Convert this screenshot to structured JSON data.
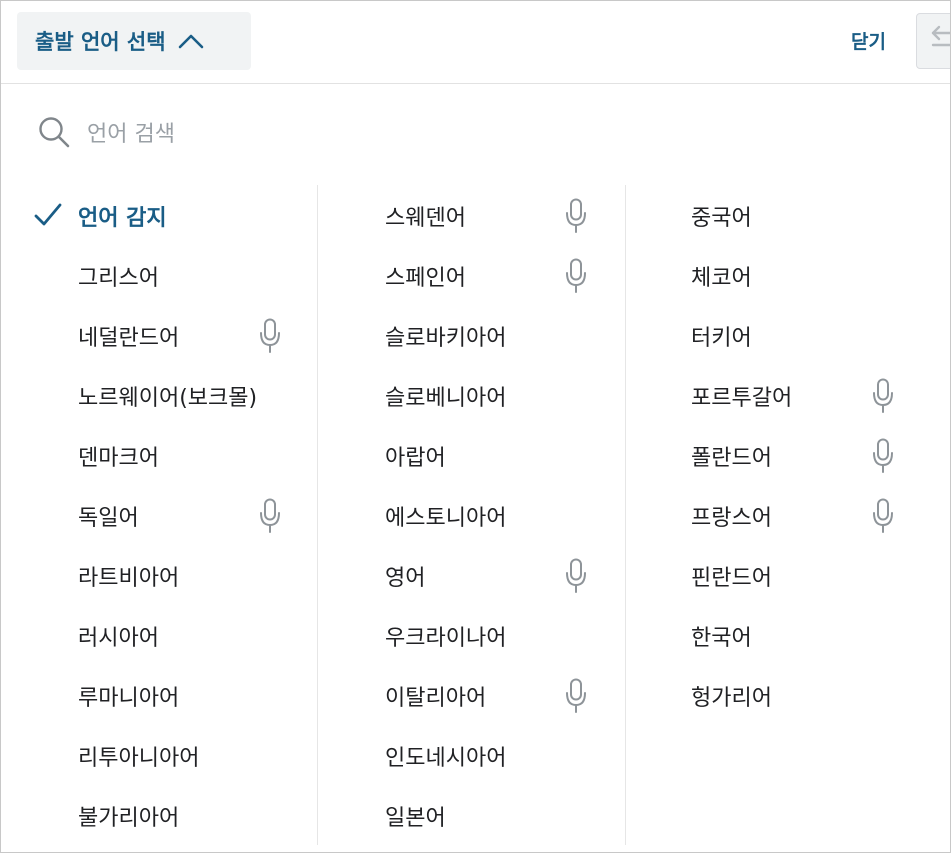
{
  "header": {
    "source_label": "출발 언어 선택",
    "close_label": "닫기"
  },
  "search": {
    "placeholder": "언어 검색"
  },
  "colors": {
    "accent": "#1a5d86",
    "text": "#202124",
    "muted": "#9aa0a6",
    "button_bg": "#f1f3f4"
  },
  "languages": {
    "col1": [
      {
        "label": "언어 감지",
        "selected": true,
        "mic": false
      },
      {
        "label": "그리스어",
        "mic": false
      },
      {
        "label": "네덜란드어",
        "mic": true
      },
      {
        "label": "노르웨이어(보크몰)",
        "mic": false
      },
      {
        "label": "덴마크어",
        "mic": false
      },
      {
        "label": "독일어",
        "mic": true
      },
      {
        "label": "라트비아어",
        "mic": false
      },
      {
        "label": "러시아어",
        "mic": false
      },
      {
        "label": "루마니아어",
        "mic": false
      },
      {
        "label": "리투아니아어",
        "mic": false
      },
      {
        "label": "불가리아어",
        "mic": false
      }
    ],
    "col2": [
      {
        "label": "스웨덴어",
        "mic": true
      },
      {
        "label": "스페인어",
        "mic": true
      },
      {
        "label": "슬로바키아어",
        "mic": false
      },
      {
        "label": "슬로베니아어",
        "mic": false
      },
      {
        "label": "아랍어",
        "mic": false
      },
      {
        "label": "에스토니아어",
        "mic": false
      },
      {
        "label": "영어",
        "mic": true
      },
      {
        "label": "우크라이나어",
        "mic": false
      },
      {
        "label": "이탈리아어",
        "mic": true
      },
      {
        "label": "인도네시아어",
        "mic": false
      },
      {
        "label": "일본어",
        "mic": false
      }
    ],
    "col3": [
      {
        "label": "중국어",
        "mic": false
      },
      {
        "label": "체코어",
        "mic": false
      },
      {
        "label": "터키어",
        "mic": false
      },
      {
        "label": "포르투갈어",
        "mic": true
      },
      {
        "label": "폴란드어",
        "mic": true
      },
      {
        "label": "프랑스어",
        "mic": true
      },
      {
        "label": "핀란드어",
        "mic": false
      },
      {
        "label": "한국어",
        "mic": false
      },
      {
        "label": "헝가리어",
        "mic": false
      }
    ]
  },
  "icons": {
    "selected": "checkmark-icon",
    "voice": "microphone-icon",
    "search": "search-icon",
    "collapse": "chevron-up-icon",
    "swap": "swap-arrows-icon"
  }
}
